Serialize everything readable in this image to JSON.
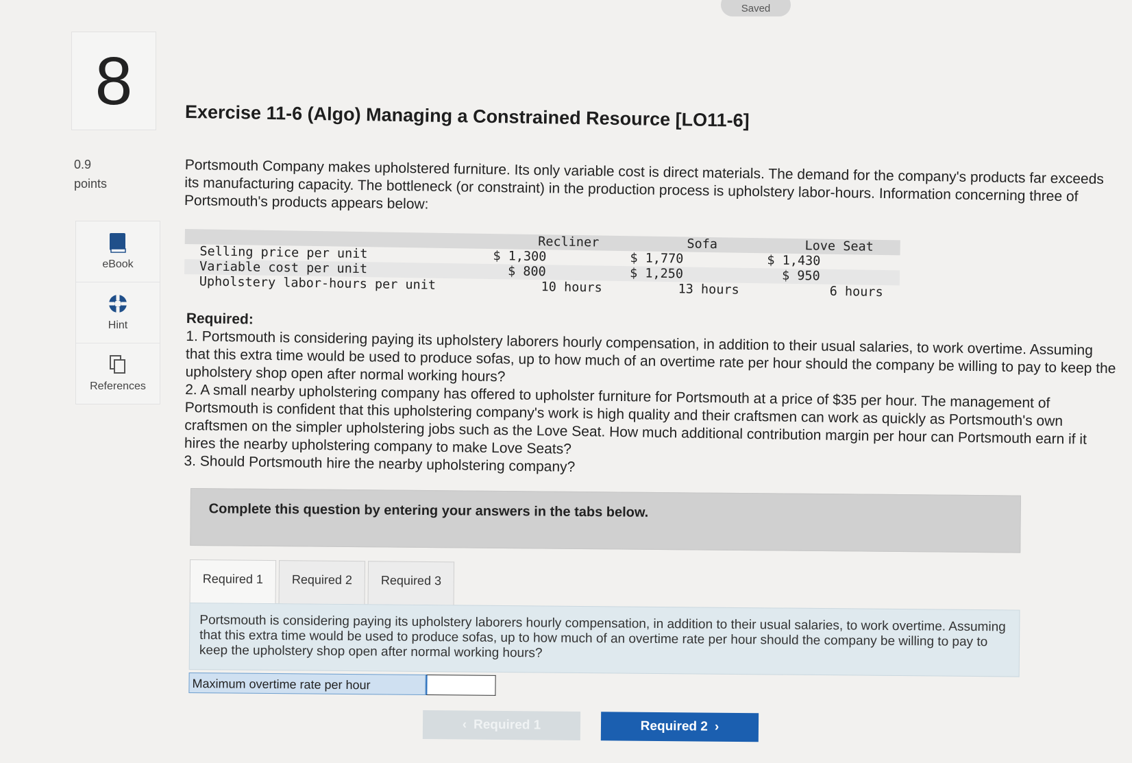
{
  "header": {
    "saved_status": "Saved"
  },
  "question": {
    "number": "8",
    "points_value": "0.9",
    "points_label": "points"
  },
  "sidebar": {
    "tools": [
      {
        "label": "eBook",
        "icon": "book-icon"
      },
      {
        "label": "Hint",
        "icon": "lifebuoy-icon"
      },
      {
        "label": "References",
        "icon": "copy-pages-icon"
      }
    ]
  },
  "exercise": {
    "title": "Exercise 11-6 (Algo) Managing a Constrained Resource [LO11-6]",
    "intro": "Portsmouth Company makes upholstered furniture. Its only variable cost is direct materials. The demand for the company's products far exceeds its manufacturing capacity. The bottleneck (or constraint) in the production process is upholstery labor-hours. Information concerning three of Portsmouth's products appears below:"
  },
  "table": {
    "headers": [
      "Recliner",
      "Sofa",
      "Love Seat"
    ],
    "rows": [
      {
        "label": "Selling price per unit",
        "recliner": "$ 1,300",
        "sofa": "$ 1,770",
        "love_seat": "$ 1,430"
      },
      {
        "label": "Variable cost per unit",
        "recliner": "$ 800",
        "sofa": "$ 1,250",
        "love_seat": "$ 950"
      },
      {
        "label": "Upholstery labor-hours per unit",
        "recliner": "10 hours",
        "sofa": "13 hours",
        "love_seat": "6 hours"
      }
    ]
  },
  "required": {
    "heading": "Required:",
    "items": [
      "1. Portsmouth is considering paying its upholstery laborers hourly compensation, in addition to their usual salaries, to work overtime. Assuming that this extra time would be used to produce sofas, up to how much of an overtime rate per hour should the company be willing to pay to keep the upholstery shop open after normal working hours?",
      "2. A small nearby upholstering company has offered to upholster furniture for Portsmouth at a price of $35 per hour. The management of Portsmouth is confident that this upholstering company's work is high quality and their craftsmen can work as quickly as Portsmouth's own craftsmen on the simpler upholstering jobs such as the Love Seat. How much additional contribution margin per hour can Portsmouth earn if it hires the nearby upholstering company to make Love Seats?",
      "3. Should Portsmouth hire the nearby upholstering company?"
    ]
  },
  "panel": {
    "instructions": "Complete this question by entering your answers in the tabs below.",
    "tabs": [
      "Required 1",
      "Required 2",
      "Required 3"
    ],
    "question_text": "Portsmouth is considering paying its upholstery laborers hourly compensation, in addition to their usual salaries, to work overtime. Assuming that this extra time would be used to produce sofas, up to how much of an overtime rate per hour should the company be willing to pay to keep the upholstery shop open after normal working hours?",
    "answer_label": "Maximum overtime rate per hour",
    "answer_value": "",
    "prev_button": "Required 1",
    "next_button": "Required 2"
  },
  "colors": {
    "accent": "#1b5fb0",
    "answer_label_bg": "#cfe0f1",
    "question_box_bg": "#dfe9ee"
  }
}
